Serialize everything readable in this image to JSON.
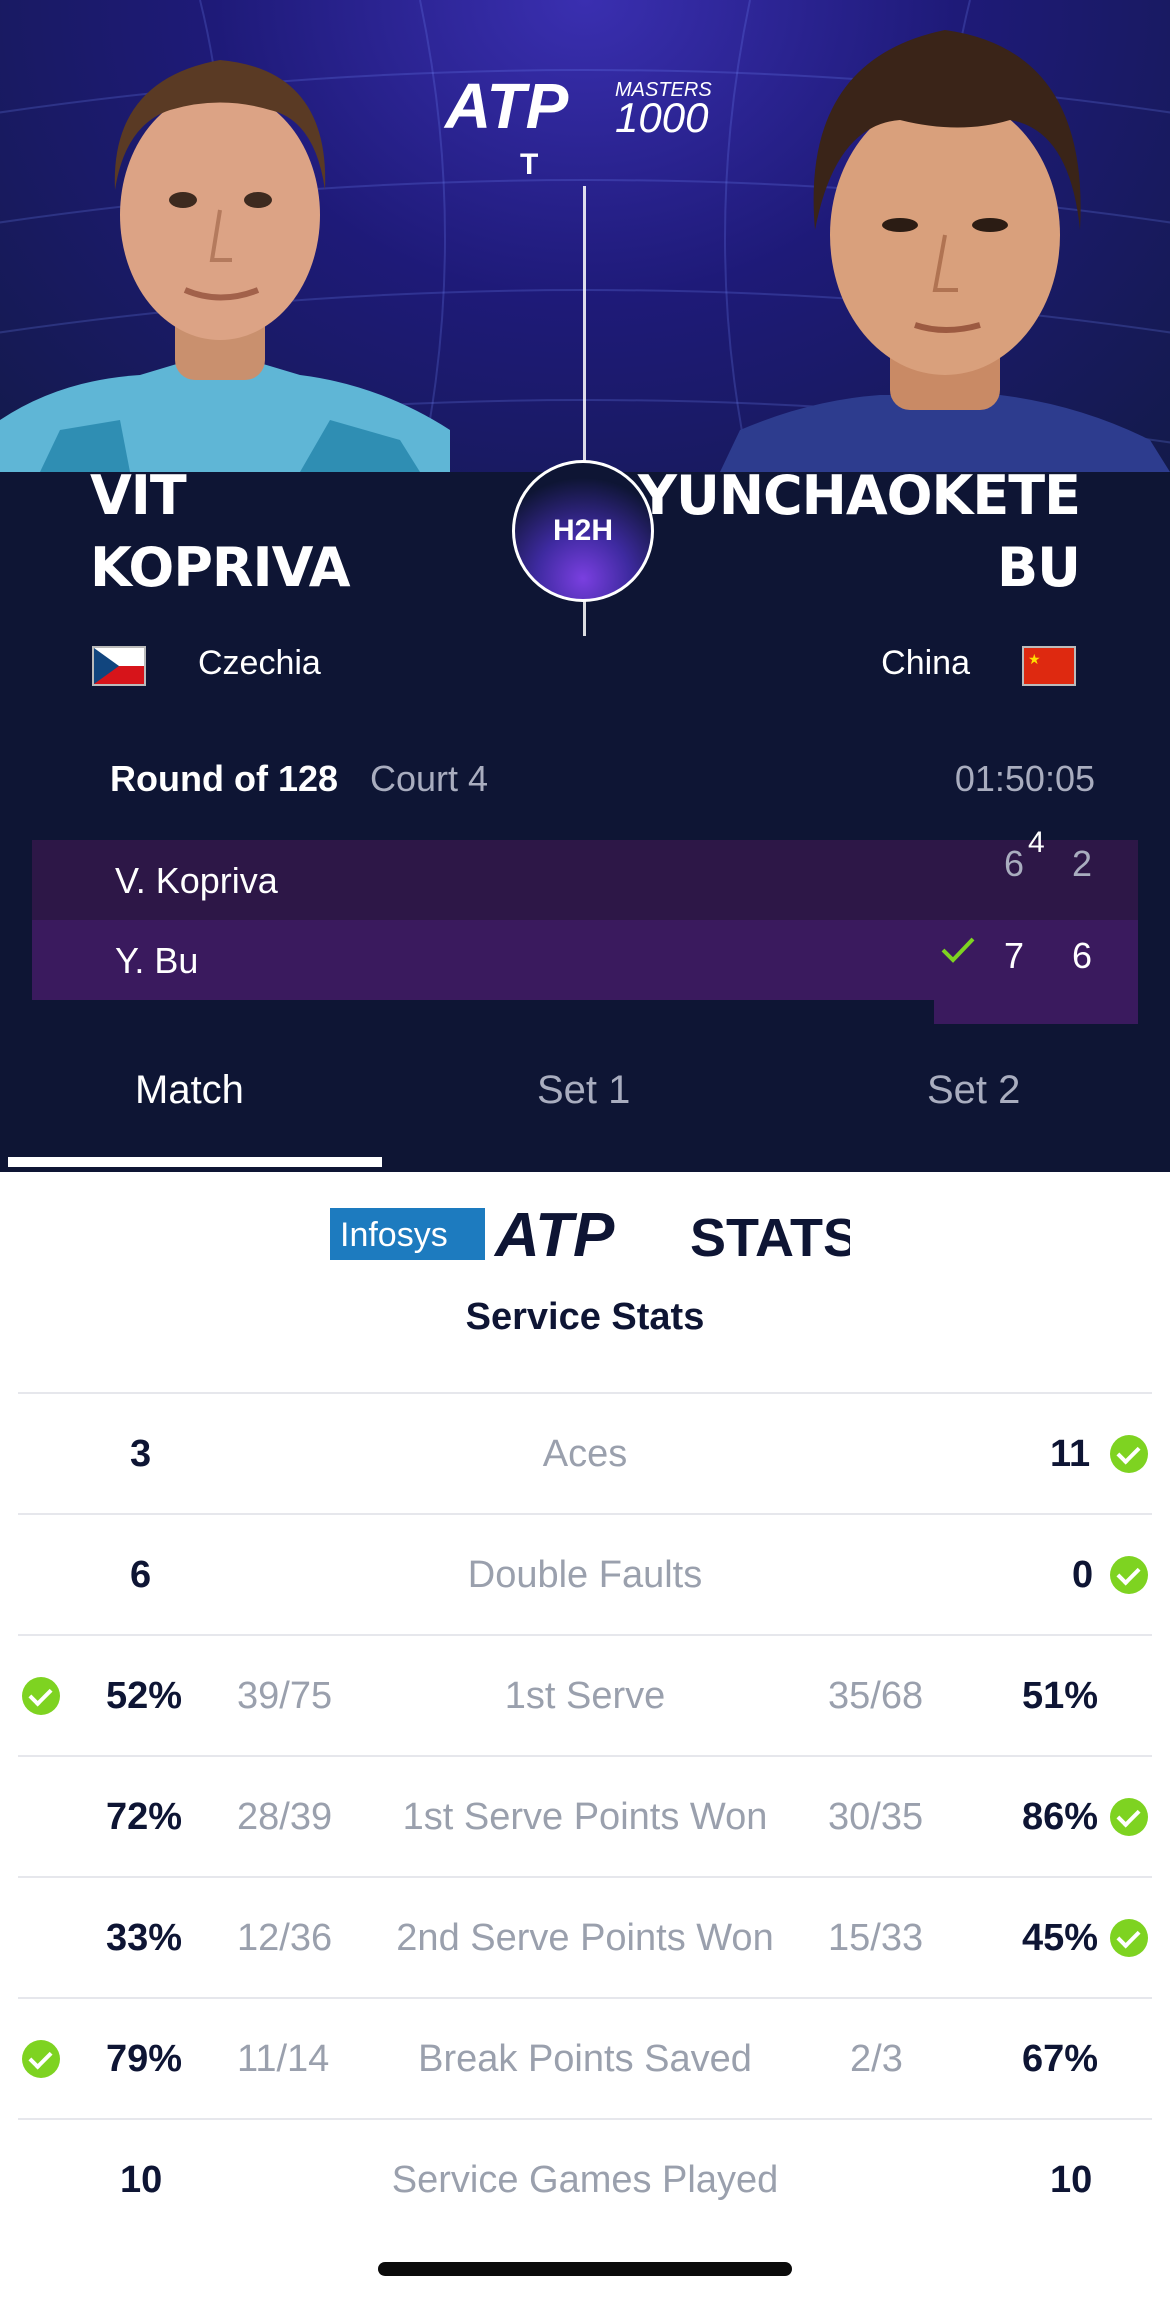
{
  "header": {
    "brand": "ATP",
    "masters_line1": "MASTERS",
    "masters_line2": "1000",
    "sub": "T",
    "h2h_label": "H2H"
  },
  "players": {
    "left": {
      "first": "VIT",
      "last": "KOPRIVA",
      "country": "Czechia",
      "short": "V. Kopriva"
    },
    "right": {
      "first": "YUNCHAOKETE",
      "last": "BU",
      "country": "China",
      "short": "Y. Bu"
    }
  },
  "match": {
    "round": "Round of 128",
    "court": "Court 4",
    "duration": "01:50:05",
    "scores": {
      "left": {
        "set1": "6",
        "set1_tiebreak": "4",
        "set2": "2"
      },
      "right": {
        "set1": "7",
        "set2": "6"
      }
    }
  },
  "tabs": [
    {
      "label": "Match",
      "active": true
    },
    {
      "label": "Set 1",
      "active": false
    },
    {
      "label": "Set 2",
      "active": false
    }
  ],
  "stats_logo": {
    "infosys": "Infosys",
    "atp": "ATP",
    "stats": "STATS"
  },
  "section_title": "Service Stats",
  "stats": [
    {
      "label": "Aces",
      "left": "3",
      "right": "11",
      "winner": "right"
    },
    {
      "label": "Double Faults",
      "left": "6",
      "right": "0",
      "winner": "right"
    },
    {
      "label": "1st Serve",
      "left": "52%",
      "left_frac": "39/75",
      "right": "51%",
      "right_frac": "35/68",
      "winner": "left"
    },
    {
      "label": "1st Serve Points Won",
      "left": "72%",
      "left_frac": "28/39",
      "right": "86%",
      "right_frac": "30/35",
      "winner": "right"
    },
    {
      "label": "2nd Serve Points Won",
      "left": "33%",
      "left_frac": "12/36",
      "right": "45%",
      "right_frac": "15/33",
      "winner": "right"
    },
    {
      "label": "Break Points Saved",
      "left": "79%",
      "left_frac": "11/14",
      "right": "67%",
      "right_frac": "2/3",
      "winner": "left"
    },
    {
      "label": "Service Games Played",
      "left": "10",
      "right": "10",
      "winner": "none"
    }
  ],
  "colors": {
    "dark_bg": "#0e1534",
    "row_purple": "#2d1747",
    "row_purple_win": "#3a1a5e",
    "win_green": "#7ed321",
    "accent_purple": "#7a3fe0"
  }
}
